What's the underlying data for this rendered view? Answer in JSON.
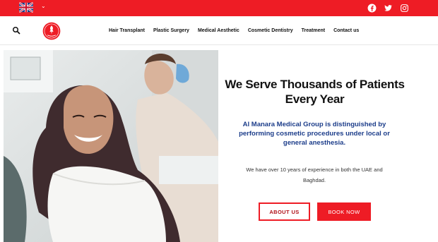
{
  "topbar": {
    "language_caret": "⌄",
    "social_icons": [
      "facebook-icon",
      "twitter-icon",
      "instagram-icon"
    ]
  },
  "nav": {
    "items": [
      {
        "label": "Hair Transplant"
      },
      {
        "label": "Plastic Surgery"
      },
      {
        "label": "Medical Aesthetic"
      },
      {
        "label": "Cosmetic Dentistry"
      },
      {
        "label": "Treatment"
      },
      {
        "label": "Contact us"
      }
    ]
  },
  "hero": {
    "headline": "We Serve Thousands of Patients Every Year",
    "subhead": "Al Manara Medical Group is distinguished by performing cosmetic procedures under local or general anesthesia.",
    "body": "We have over 10 years of experience in both the UAE and Baghdad.",
    "about_label": "ABOUT US",
    "book_label": "BOOK NOW"
  },
  "colors": {
    "brand_red": "#ee1c25",
    "subhead_blue": "#1c3d8a"
  }
}
